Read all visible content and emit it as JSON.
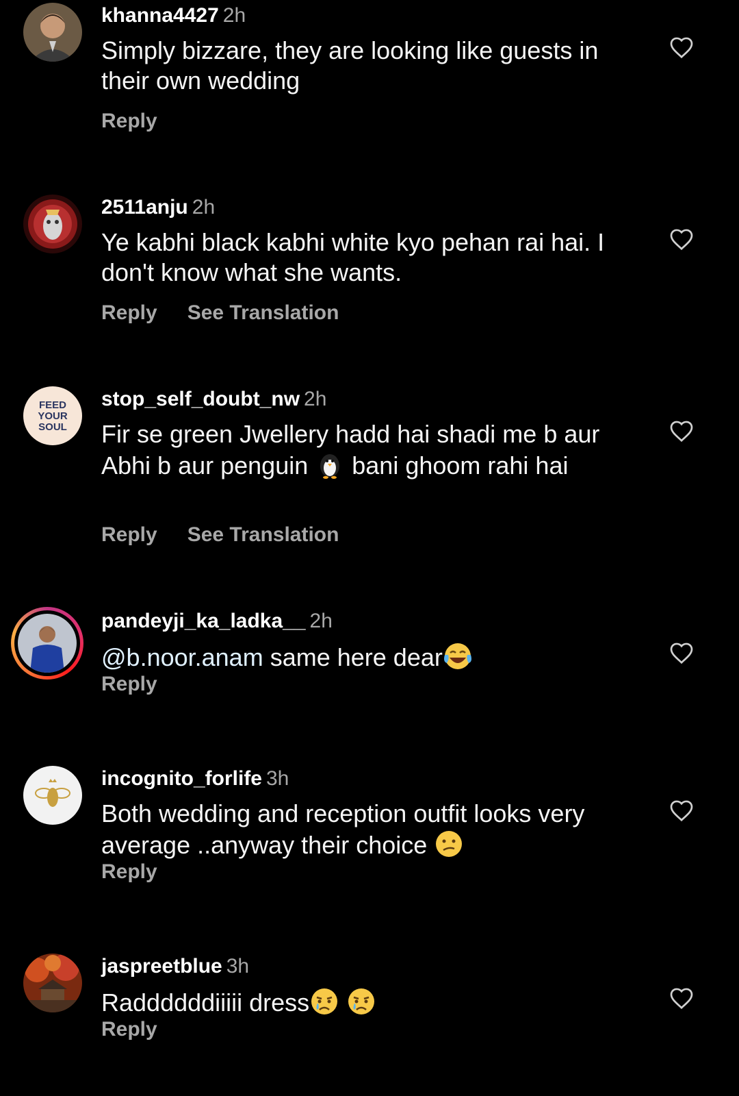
{
  "comments": [
    {
      "username": "khanna4427",
      "time": "2h",
      "text": "Simply bizzare, they are looking like guests in their own wedding",
      "reply_label": "Reply"
    },
    {
      "username": "2511anju",
      "time": "2h",
      "text": "Ye kabhi black kabhi white kyo pehan rai hai. I don't know what she wants.",
      "reply_label": "Reply",
      "translate_label": "See Translation"
    },
    {
      "username": "stop_self_doubt_nw",
      "time": "2h",
      "text_before": "Fir se green Jwellery hadd hai shadi me b aur Abhi b aur penguin ",
      "emoji": "penguin",
      "text_after": " bani ghoom rahi hai",
      "reply_label": "Reply",
      "translate_label": "See Translation",
      "avatar_text": [
        "FEED",
        "YOUR",
        "SOUL"
      ]
    },
    {
      "username": "pandeyji_ka_ladka__",
      "time": "2h",
      "mention": "@b.noor.anam",
      "text": " same here dear",
      "emoji": "face-with-tears-of-joy",
      "reply_label": "Reply"
    },
    {
      "username": "incognito_forlife",
      "time": "3h",
      "text": "Both wedding and reception outfit looks very average ..anyway their  choice ",
      "emoji": "confused-face",
      "reply_label": "Reply"
    },
    {
      "username": "jaspreetblue",
      "time": "3h",
      "text": "Raddddddiiiii dress",
      "emoji": "crying-face",
      "reply_label": "Reply"
    }
  ],
  "colors": {
    "background": "#000000",
    "text": "#f5f5f5",
    "muted": "#a8a8a8",
    "mention": "#e0f1ff"
  }
}
